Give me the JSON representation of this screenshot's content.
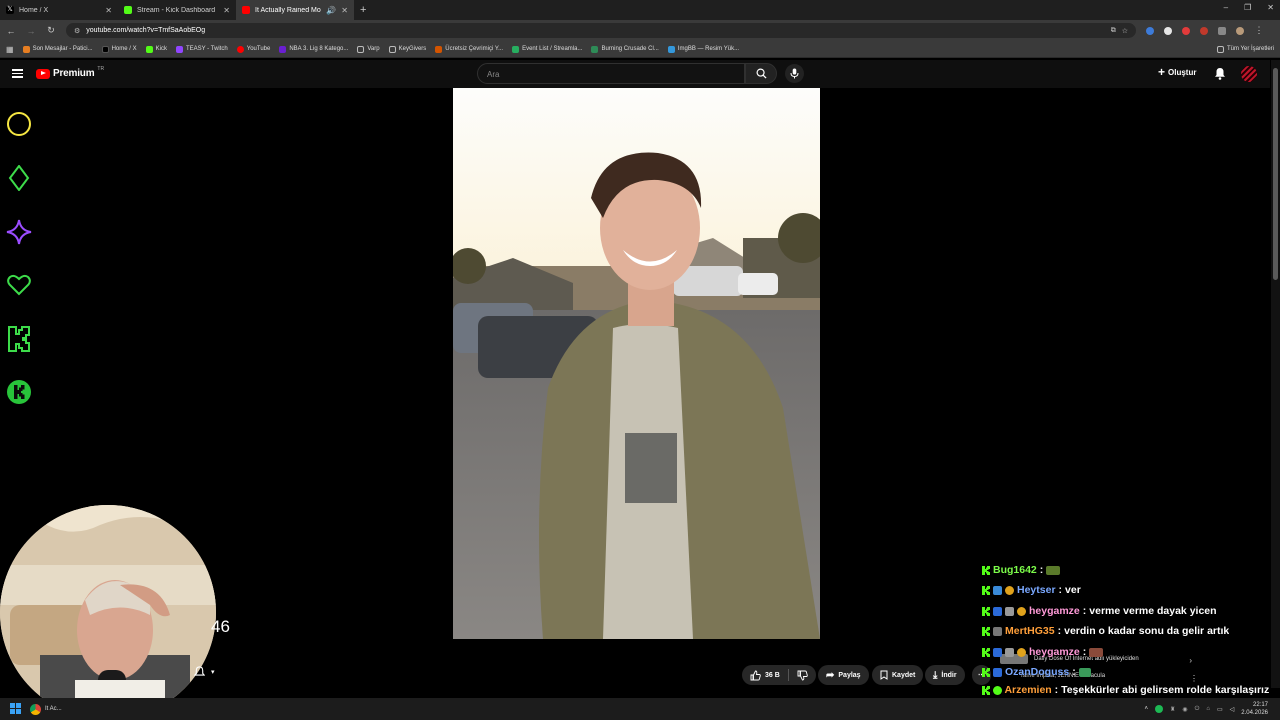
{
  "browser": {
    "tabs": [
      {
        "title": "Home / X",
        "active": false,
        "icon": "x-logo-icon"
      },
      {
        "title": "Stream - Kick Dashboard",
        "active": false,
        "icon": "kick-logo-icon"
      },
      {
        "title": "It Actually Rained Money -",
        "active": true,
        "icon": "youtube-logo-icon"
      }
    ],
    "url": "youtube.com/watch?v=TmfSaAobEOg",
    "bookmarks": [
      "Son Mesajlar - Patici...",
      "Home / X",
      "Kick",
      "TEASY - Twitch",
      "YouTube",
      "NBA 3. Lig 8 Katego...",
      "Varp",
      "KeyGivers",
      "Ücretsiz Çevrimiçi Y...",
      "Event List / Streamla...",
      "Burning Crusade Cl...",
      "ImgBB — Resim Yük..."
    ],
    "bookmarks_right": "Tüm Yer İşaretleri"
  },
  "youtube": {
    "logo_text": "Premium",
    "region_code": "TR",
    "search_placeholder": "Ara",
    "create_label": "Oluştur",
    "like_count": "36 B",
    "share_label": "Paylaş",
    "save_label": "Kaydet",
    "download_label": "İndir"
  },
  "overlay": {
    "webcam_side_number": "46"
  },
  "chat": [
    {
      "user": "Bug1642",
      "user_color": "#7cfc4a",
      "message": ""
    },
    {
      "user": "Heytser",
      "user_color": "#7aa8ff",
      "message": "ver"
    },
    {
      "user": "heygamze",
      "user_color": "#ff9ad8",
      "message": "verme verme dayak yicen"
    },
    {
      "user": "MertHG35",
      "user_color": "#ff9f3a",
      "message": "verdin o kadar sonu da gelir artık"
    },
    {
      "user": "heygamze",
      "user_color": "#ff9ad8",
      "message": ""
    },
    {
      "user": "OzanDoguss",
      "user_color": "#7aa8ff",
      "message": ""
    },
    {
      "user": "Arzemien",
      "user_color": "#ff9f3a",
      "message": "Teşekkürler abi gelirsem rolde karşılaşırız zaten"
    }
  ],
  "music_toast": {
    "line1": "Daily Dose Of Internet adlı yükleyiciden",
    "line2": "Tame Impala, JENNIE - Dracula"
  },
  "taskbar": {
    "chrome_label": "It Ac...",
    "time": "22:17",
    "date": "2.04.2026"
  }
}
